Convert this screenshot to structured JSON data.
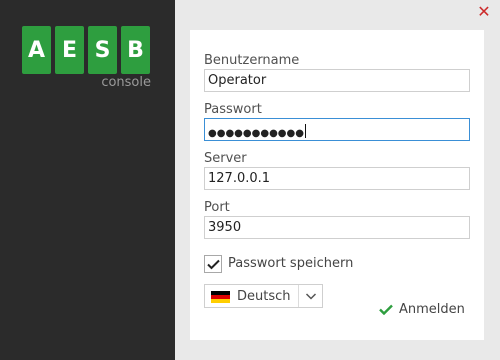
{
  "logo": {
    "letters": [
      "A",
      "E",
      "S",
      "B"
    ],
    "subtitle": "console",
    "tile_color": "#2e9e3f"
  },
  "window": {
    "close_icon": "✕"
  },
  "form": {
    "username": {
      "label": "Benutzername",
      "value": "Operator"
    },
    "password": {
      "label": "Passwort",
      "value": "●●●●●●●●●●●"
    },
    "server": {
      "label": "Server",
      "value": "127.0.0.1"
    },
    "port": {
      "label": "Port",
      "value": "3950"
    },
    "remember": {
      "label": "Passwort speichern",
      "checked": true
    },
    "language": {
      "selected": "Deutsch",
      "flag": "de-flag-icon"
    },
    "login_label": "Anmelden"
  },
  "colors": {
    "accent_green": "#2e9e3f",
    "focus_blue": "#3a8fd6",
    "close_red": "#cc2a2a"
  }
}
